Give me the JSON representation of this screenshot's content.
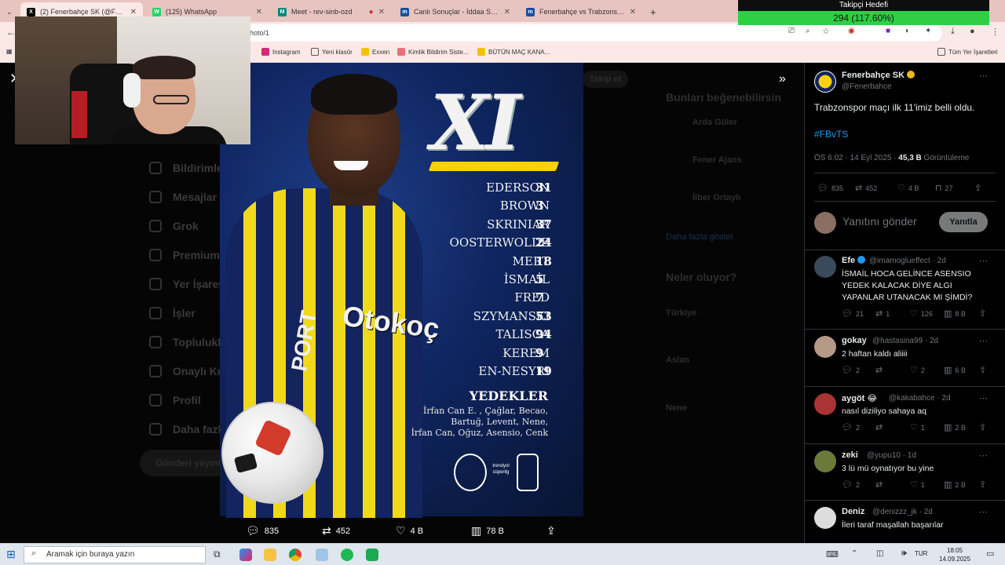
{
  "browser": {
    "tabs": [
      {
        "title": "(2) Fenerbahçe SK (@Fenerbahce",
        "favicon": "X",
        "color": "#000000",
        "active": true
      },
      {
        "title": "(125) WhatsApp",
        "favicon": "W",
        "color": "#25d366",
        "active": false
      },
      {
        "title": "Meet - rev-sinb-ozd",
        "favicon": "M",
        "color": "#00897b",
        "active": false
      },
      {
        "title": "Canlı Sonuçlar - İddaa Sonuçla",
        "favicon": "m",
        "color": "#1a4ea0",
        "active": false
      },
      {
        "title": "Fenerbahçe vs Trabzonspor, 14.",
        "favicon": "m",
        "color": "#1a4ea0",
        "active": false
      }
    ],
    "new_tab": "+",
    "address": "hoto/1",
    "bookmarks": [
      "Instagram",
      "Yeni klasör",
      "Exxen",
      "Kimlik Bildirim Siste...",
      "BÜTÜN MAÇ KANA..."
    ],
    "all_bookmarks": "Tüm Yer İşaretleri"
  },
  "overlay": {
    "target_label": "Takipçi Hedefi",
    "target_value": "294 (117.60%)"
  },
  "background_nav": [
    "Bildirimler",
    "Mesajlar",
    "Grok",
    "Premium",
    "Yer İşaretleri",
    "İşler",
    "Topluluklar",
    "Onaylı Kuruluşlar",
    "Profil",
    "Daha fazla"
  ],
  "background_post_button": "Gönderi yayınla",
  "background_side": {
    "follow_button": "Takip et",
    "suggest_title": "Bunları beğenebilirsin",
    "suggest_names": [
      "Arda Güler",
      "Fener Ajans",
      "İlber Ortaylı"
    ],
    "show_more": "Daha fazla göster",
    "whats_happening": "Neler oluyor?",
    "trends": [
      "Türkiye",
      "Aslan",
      "Nene"
    ]
  },
  "poster": {
    "title": "XI",
    "lineup": [
      {
        "name": "EDERSON",
        "number": "31"
      },
      {
        "name": "BROWN",
        "number": "3"
      },
      {
        "name": "SKRINIAR",
        "number": "37"
      },
      {
        "name": "OOSTERWOLDE",
        "number": "24"
      },
      {
        "name": "MERT",
        "number": "18"
      },
      {
        "name": "İSMAİL",
        "number": "5"
      },
      {
        "name": "FRED",
        "number": "7"
      },
      {
        "name": "SZYMANSKI",
        "number": "53"
      },
      {
        "name": "TALISCA",
        "number": "94"
      },
      {
        "name": "KEREM",
        "number": "9"
      },
      {
        "name": "EN-NESYRI",
        "number": "19"
      }
    ],
    "subs_title": "YEDEKLER",
    "subs_lines": [
      "İrfan Can E. , Çağlar, Becao,",
      "Bartuğ, Levent, Nene,",
      "İrfan Can, Oğuz, Asensio, Cenk"
    ],
    "sponsor": "Otokoç",
    "sleeve": "PORT",
    "league_logo": "trendyol süperlig"
  },
  "media_actions": {
    "replies": "835",
    "reposts": "452",
    "likes": "4 B",
    "views": "78 B"
  },
  "tweet": {
    "name": "Fenerbahçe SK",
    "handle": "@Fenerbahce",
    "text": "Trabzonspor maçı ilk 11'imiz belli oldu.",
    "hashtag": "#FBvTS",
    "time": "ÖS 6:02 · 14 Eyl 2025 ·",
    "views_count": "45,3 B",
    "views_label": "Görüntüleme",
    "replies": "835",
    "reposts": "452",
    "likes": "4 B",
    "bookmarks": "27",
    "reply_placeholder": "Yanıtını gönder",
    "reply_button": "Yanıtla"
  },
  "replies": [
    {
      "name": "Efe",
      "handle": "@imamoglueffect · 2d",
      "text": "İSMAİL HOCA GELİNCE ASENSIO YEDEK KALACAK DİYE ALGI YAPANLAR UTANACAK MI ŞİMDİ?",
      "replies": "21",
      "reposts": "1",
      "likes": "126",
      "views": "8 B",
      "verified": true
    },
    {
      "name": "gokay",
      "handle": "@hastasina99 · 2d",
      "text": "2 haftan kaldı aliiii",
      "replies": "2",
      "reposts": "",
      "likes": "2",
      "views": "6 B",
      "verified": false
    },
    {
      "name": "aygöt 😂",
      "handle": "@kakabahce · 2d",
      "text": "nasıl diziliyo sahaya aq",
      "replies": "2",
      "reposts": "",
      "likes": "1",
      "views": "2 B",
      "verified": false
    },
    {
      "name": "zeki",
      "handle": "@yupu10 · 1d",
      "text": "3 lü mü oynatıyor bu yine",
      "replies": "2",
      "reposts": "",
      "likes": "1",
      "views": "2 B",
      "verified": false
    },
    {
      "name": "Deniz",
      "handle": "@denizzz_jk · 2d",
      "text": "İleri taraf maşallah başarılar",
      "replies": "",
      "reposts": "",
      "likes": "",
      "views": "",
      "verified": false
    }
  ],
  "taskbar": {
    "search_placeholder": "Aramak için buraya yazın",
    "language": "TUR",
    "time": "18:05",
    "date": "14.09.2025"
  }
}
